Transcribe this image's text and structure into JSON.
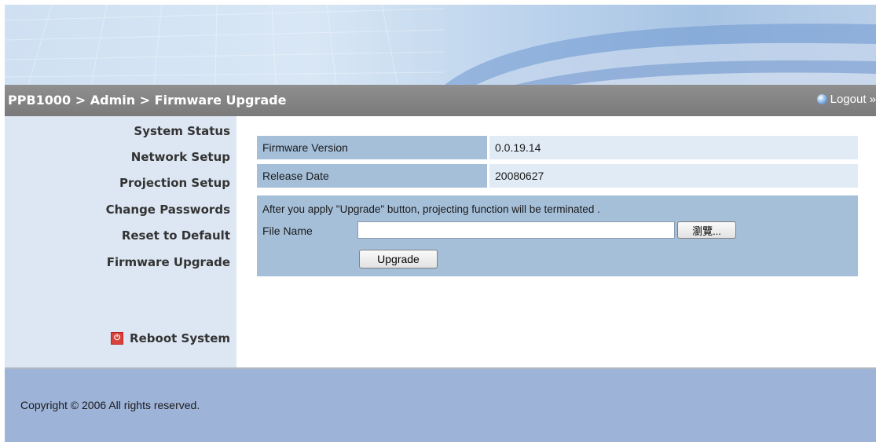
{
  "header": {
    "breadcrumb": "PPB1000 > Admin > Firmware Upgrade",
    "logout_label": "Logout »"
  },
  "sidebar": {
    "items": [
      {
        "label": "System Status"
      },
      {
        "label": "Network Setup"
      },
      {
        "label": "Projection Setup"
      },
      {
        "label": "Change Passwords"
      },
      {
        "label": "Reset to Default"
      },
      {
        "label": "Firmware Upgrade"
      }
    ],
    "reboot_label": "Reboot System"
  },
  "firmware": {
    "version_label": "Firmware Version",
    "version_value": "0.0.19.14",
    "date_label": "Release Date",
    "date_value": "20080627",
    "notice": "After you apply \"Upgrade\" button, projecting function will be terminated .",
    "file_name_label": "File Name",
    "file_name_value": "",
    "browse_label": "瀏覽...",
    "upgrade_label": "Upgrade"
  },
  "footer": {
    "copyright": "Copyright © 2006 All rights reserved."
  },
  "colors": {
    "title_bar": "#808080",
    "sidebar_bg": "#dde7f3",
    "label_cell": "#a5bfd9",
    "value_cell": "#e1ebf6",
    "footer_bg": "#9db3d8"
  },
  "icons": {
    "logout": "blue-orb-icon",
    "reboot": "power-icon"
  }
}
